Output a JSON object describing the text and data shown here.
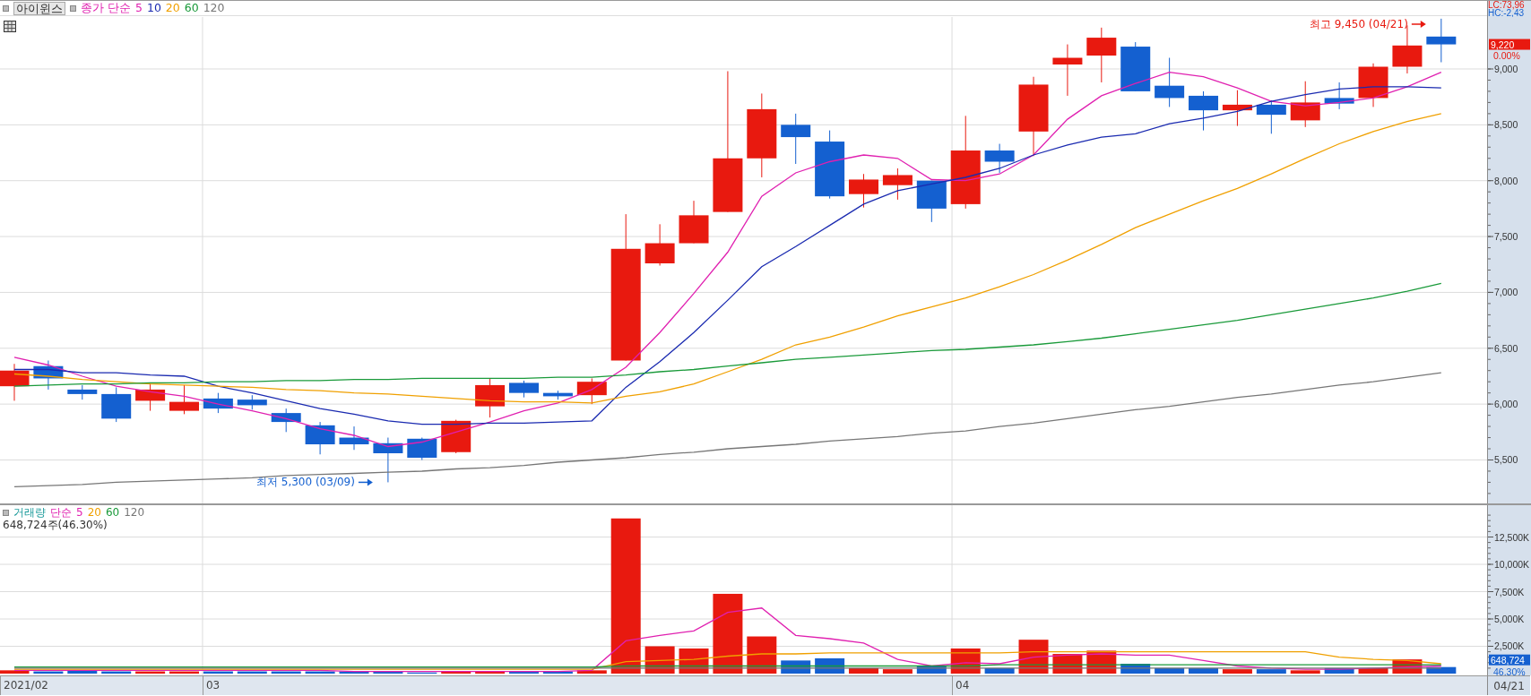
{
  "header": {
    "stock_name": "아이윈스",
    "legend_method": "종가 단순",
    "lc": "LC:73,96",
    "hc": "HC:-2,43"
  },
  "price_pane": {
    "last_price": "9,220",
    "change": "0.00%",
    "chart_data": {
      "type": "line",
      "grid": true,
      "ylim": [
        5111,
        9465
      ],
      "yticks": [
        {
          "value": 5500,
          "label": "5,500"
        },
        {
          "value": 6000,
          "label": "6,000"
        },
        {
          "value": 6500,
          "label": "6,500"
        },
        {
          "value": 7000,
          "label": "7,000"
        },
        {
          "value": 7500,
          "label": "7,500"
        },
        {
          "value": 8000,
          "label": "8,000"
        },
        {
          "value": 8500,
          "label": "8,500"
        },
        {
          "value": 9000,
          "label": "9,000"
        }
      ],
      "series": [
        {
          "type": "candlestick",
          "ohlc": [
            [
              6160,
              6360,
              6030,
              6300
            ],
            [
              6340,
              6390,
              6130,
              6230
            ],
            [
              6130,
              6170,
              6040,
              6090
            ],
            [
              6090,
              6150,
              5840,
              5870
            ],
            [
              6030,
              6180,
              5940,
              6130
            ],
            [
              5940,
              6170,
              5910,
              6020
            ],
            [
              6050,
              6100,
              5920,
              5960
            ],
            [
              6040,
              6080,
              5950,
              5990
            ],
            [
              5920,
              5960,
              5750,
              5840
            ],
            [
              5810,
              5840,
              5550,
              5640
            ],
            [
              5700,
              5800,
              5590,
              5640
            ],
            [
              5650,
              5700,
              5300,
              5560
            ],
            [
              5690,
              5700,
              5500,
              5520
            ],
            [
              5570,
              5860,
              5560,
              5850
            ],
            [
              5980,
              6230,
              5880,
              6170
            ],
            [
              6190,
              6210,
              6060,
              6100
            ],
            [
              6100,
              6120,
              6040,
              6070
            ],
            [
              6080,
              6230,
              6000,
              6200
            ],
            [
              6390,
              7700,
              6390,
              7390
            ],
            [
              7260,
              7610,
              7240,
              7440
            ],
            [
              7440,
              7820,
              7440,
              7690
            ],
            [
              7720,
              8980,
              7720,
              8200
            ],
            [
              8200,
              8780,
              8030,
              8640
            ],
            [
              8500,
              8600,
              8150,
              8390
            ],
            [
              8350,
              8450,
              7840,
              7860
            ],
            [
              7880,
              8060,
              7760,
              8010
            ],
            [
              7960,
              8110,
              7830,
              8050
            ],
            [
              8000,
              8000,
              7630,
              7750
            ],
            [
              7790,
              8580,
              7750,
              8270
            ],
            [
              8270,
              8330,
              8070,
              8170
            ],
            [
              8440,
              8930,
              8220,
              8860
            ],
            [
              9040,
              9220,
              8760,
              9100
            ],
            [
              9120,
              9370,
              8880,
              9280
            ],
            [
              9200,
              9240,
              8800,
              8800
            ],
            [
              8850,
              9100,
              8660,
              8740
            ],
            [
              8760,
              8800,
              8450,
              8630
            ],
            [
              8630,
              8810,
              8490,
              8680
            ],
            [
              8680,
              8720,
              8420,
              8590
            ],
            [
              8540,
              8890,
              8480,
              8700
            ],
            [
              8740,
              8880,
              8640,
              8690
            ],
            [
              8740,
              9050,
              8660,
              9020
            ],
            [
              9020,
              9390,
              8960,
              9210
            ],
            [
              9290,
              9450,
              9060,
              9220
            ]
          ]
        },
        {
          "name": "5",
          "color": "#e020b0",
          "values": [
            6420,
            6350,
            6250,
            6160,
            6110,
            6070,
            6000,
            5940,
            5870,
            5780,
            5720,
            5620,
            5660,
            5750,
            5840,
            5940,
            6010,
            6130,
            6330,
            6640,
            6990,
            7360,
            7860,
            8070,
            8170,
            8230,
            8200,
            8010,
            8000,
            8060,
            8230,
            8550,
            8760,
            8870,
            8970,
            8930,
            8830,
            8710,
            8670,
            8700,
            8740,
            8840,
            8970
          ]
        },
        {
          "name": "10",
          "color": "#1a2ab0",
          "values": [
            6310,
            6310,
            6280,
            6280,
            6260,
            6250,
            6160,
            6100,
            6030,
            5960,
            5910,
            5850,
            5820,
            5820,
            5830,
            5830,
            5840,
            5850,
            6150,
            6380,
            6640,
            6930,
            7230,
            7410,
            7600,
            7790,
            7910,
            7970,
            8030,
            8110,
            8230,
            8320,
            8390,
            8420,
            8510,
            8560,
            8620,
            8710,
            8770,
            8820,
            8840,
            8840,
            8830
          ]
        },
        {
          "name": "20",
          "color": "#f0a000",
          "values": [
            6270,
            6250,
            6220,
            6200,
            6180,
            6170,
            6160,
            6150,
            6130,
            6120,
            6100,
            6090,
            6070,
            6050,
            6030,
            6020,
            6020,
            6010,
            6070,
            6110,
            6180,
            6290,
            6400,
            6530,
            6600,
            6690,
            6790,
            6870,
            6950,
            7050,
            7160,
            7290,
            7430,
            7580,
            7700,
            7820,
            7930,
            8060,
            8200,
            8330,
            8440,
            8530,
            8600
          ]
        },
        {
          "name": "60",
          "color": "#1a9a3a",
          "values": [
            6160,
            6170,
            6180,
            6180,
            6190,
            6190,
            6200,
            6200,
            6210,
            6210,
            6220,
            6220,
            6230,
            6230,
            6230,
            6230,
            6240,
            6240,
            6260,
            6290,
            6310,
            6340,
            6370,
            6400,
            6420,
            6440,
            6460,
            6480,
            6490,
            6510,
            6530,
            6560,
            6590,
            6630,
            6670,
            6710,
            6750,
            6800,
            6850,
            6900,
            6950,
            7010,
            7080
          ]
        },
        {
          "name": "120",
          "color": "#777777",
          "values": [
            5260,
            5270,
            5280,
            5300,
            5310,
            5320,
            5330,
            5340,
            5360,
            5370,
            5380,
            5390,
            5400,
            5420,
            5430,
            5450,
            5480,
            5500,
            5520,
            5550,
            5570,
            5600,
            5620,
            5640,
            5670,
            5690,
            5710,
            5740,
            5760,
            5800,
            5830,
            5870,
            5910,
            5950,
            5980,
            6020,
            6060,
            6090,
            6130,
            6170,
            6200,
            6240,
            6280
          ]
        }
      ],
      "annotations": [
        "최고 9,450 (04/21)",
        "최저 5,300 (03/09)"
      ]
    }
  },
  "volume_pane": {
    "legend_title": "거래량",
    "legend_method": "단순",
    "summary": "648,724주(46.30%)",
    "last_volume": "648,724",
    "ratio": "46.30%",
    "chart_data": {
      "type": "bar",
      "grid": true,
      "ylim": [
        -164,
        15410
      ],
      "yticks": [
        {
          "value": 2500,
          "label": "2,500K"
        },
        {
          "value": 5000,
          "label": "5,000K"
        },
        {
          "value": 7500,
          "label": "7,500K"
        },
        {
          "value": 10000,
          "label": "10,000K"
        },
        {
          "value": 12500,
          "label": "12,500K"
        }
      ],
      "series": [
        {
          "colors": [
            "#e8190f",
            "#1460d0",
            "#1460d0",
            "#1460d0",
            "#e8190f",
            "#e8190f",
            "#1460d0",
            "#1460d0",
            "#1460d0",
            "#1460d0",
            "#1460d0",
            "#1460d0",
            "#1460d0",
            "#e8190f",
            "#e8190f",
            "#1460d0",
            "#1460d0",
            "#e8190f",
            "#e8190f",
            "#e8190f",
            "#e8190f",
            "#e8190f",
            "#e8190f",
            "#1460d0",
            "#1460d0",
            "#e8190f",
            "#e8190f",
            "#1460d0",
            "#e8190f",
            "#1460d0",
            "#e8190f",
            "#e8190f",
            "#e8190f",
            "#1460d0",
            "#1460d0",
            "#1460d0",
            "#e8190f",
            "#1460d0",
            "#e8190f",
            "#1460d0",
            "#e8190f",
            "#e8190f",
            "#1460d0"
          ],
          "values": [
            300,
            200,
            300,
            200,
            200,
            200,
            200,
            200,
            200,
            200,
            200,
            200,
            100,
            200,
            200,
            200,
            200,
            300,
            14200,
            2500,
            2300,
            7300,
            3400,
            1200,
            1400,
            500,
            400,
            700,
            2300,
            500,
            3100,
            1800,
            2100,
            900,
            500,
            500,
            400,
            400,
            300,
            500,
            500,
            1300,
            600
          ]
        },
        {
          "name": "5",
          "type": "line",
          "color": "#e020b0",
          "values": [
            300,
            300,
            300,
            300,
            300,
            300,
            300,
            300,
            300,
            300,
            200,
            200,
            200,
            200,
            200,
            200,
            200,
            300,
            3000,
            3500,
            3900,
            5600,
            6000,
            3500,
            3200,
            2800,
            1300,
            700,
            1000,
            900,
            1500,
            1700,
            1800,
            1700,
            1700,
            1200,
            700,
            500,
            400,
            400,
            500,
            600,
            700
          ]
        },
        {
          "name": "20",
          "type": "line",
          "color": "#f0a000",
          "values": [
            400,
            400,
            400,
            400,
            400,
            400,
            400,
            400,
            400,
            400,
            400,
            400,
            400,
            400,
            400,
            400,
            400,
            400,
            1100,
            1200,
            1300,
            1600,
            1800,
            1800,
            1900,
            1900,
            1900,
            1900,
            1900,
            1900,
            2000,
            2000,
            2000,
            2000,
            2000,
            2000,
            2000,
            2000,
            2000,
            1500,
            1300,
            1200,
            900
          ]
        },
        {
          "name": "60",
          "type": "line",
          "color": "#1a9a3a",
          "values": [
            600,
            600,
            600,
            600,
            600,
            600,
            600,
            600,
            600,
            600,
            600,
            600,
            600,
            600,
            600,
            600,
            600,
            600,
            700,
            700,
            700,
            700,
            700,
            700,
            700,
            700,
            700,
            700,
            700,
            800,
            800,
            800,
            800,
            800,
            800,
            800,
            800,
            800,
            800,
            800,
            800,
            800,
            800
          ]
        },
        {
          "name": "120",
          "type": "line",
          "color": "#777777",
          "values": [
            500,
            500,
            500,
            500,
            500,
            500,
            500,
            500,
            500,
            500,
            500,
            500,
            500,
            500,
            500,
            500,
            500,
            500,
            500,
            500,
            500,
            500,
            500,
            500,
            500,
            500,
            500,
            500,
            500,
            500,
            500,
            500,
            500,
            500,
            500,
            500,
            500,
            500,
            500,
            500,
            500,
            500,
            500
          ]
        }
      ]
    }
  },
  "date_axis": {
    "labels": [
      "2021/02",
      "03",
      "04"
    ],
    "last_date": "04/21"
  }
}
